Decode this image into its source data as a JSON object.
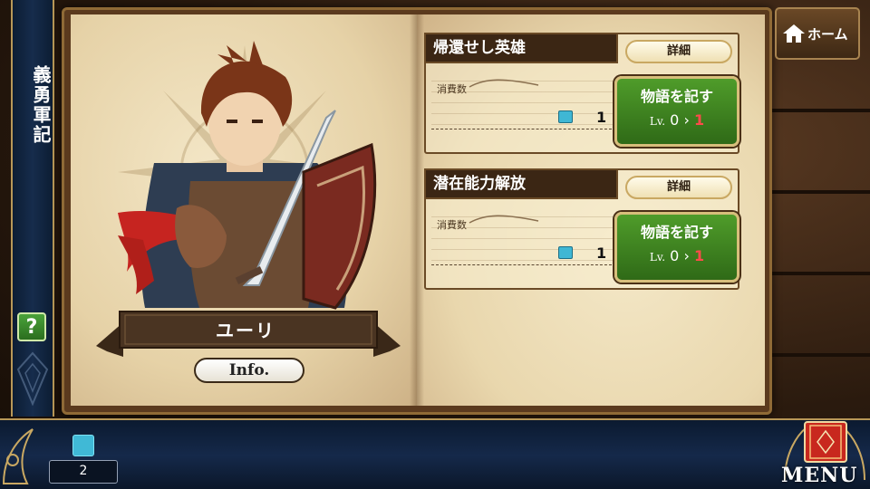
{
  "sidebar": {
    "title": "義勇軍記",
    "help_label": "?"
  },
  "character": {
    "name": "ユーリ",
    "info_label": "Info."
  },
  "panels": [
    {
      "title": "帰還せし英雄",
      "detail_label": "詳細",
      "cost_label": "消費数",
      "cost_icon": "ink-bottle-icon",
      "cost_value": "1",
      "action_label": "物語を記す",
      "level_prefix": "Lv.",
      "level_current": "0",
      "level_arrow": "›",
      "level_next": "1"
    },
    {
      "title": "潜在能力解放",
      "detail_label": "詳細",
      "cost_label": "消費数",
      "cost_icon": "ink-bottle-icon",
      "cost_value": "1",
      "action_label": "物語を記す",
      "level_prefix": "Lv.",
      "level_current": "0",
      "level_arrow": "›",
      "level_next": "1"
    }
  ],
  "header": {
    "home_label": "ホーム",
    "home_icon": "house-icon"
  },
  "footer": {
    "ink_icon": "ink-bottle-icon",
    "ink_count": "2",
    "menu_label": "MENU",
    "menu_icon": "book-icon"
  },
  "colors": {
    "panel_title_bg": "#3b2614",
    "action_green": "#3f8a23",
    "level_next": "#ff4a4a",
    "ribbon_blue": "#162c4c"
  }
}
